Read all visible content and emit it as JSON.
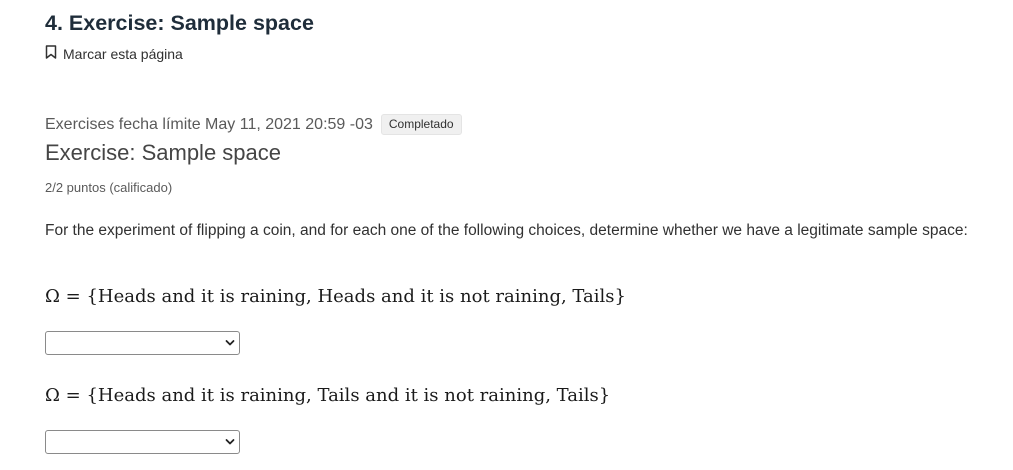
{
  "page": {
    "title": "4. Exercise: Sample space",
    "bookmark_label": "Marcar esta página"
  },
  "problem": {
    "meta_prefix": "Exercises fecha límite May 11, 2021 20:59 -03",
    "status_badge": "Completado",
    "title": "Exercise: Sample space",
    "score": "2/2 puntos (calificado)",
    "prompt": "For the experiment of flipping a coin, and for each one of the following choices, determine whether we have a legitimate sample space:",
    "questions": [
      {
        "expression": "Ω = {Heads and it is raining, Heads and it is not raining, Tails}",
        "selected": ""
      },
      {
        "expression": "Ω = {Heads and it is raining, Tails and it is not raining, Tails}",
        "selected": ""
      }
    ]
  },
  "icons": {
    "bookmark": "bookmark-icon",
    "select_chevron": "chevron-down-icon"
  }
}
